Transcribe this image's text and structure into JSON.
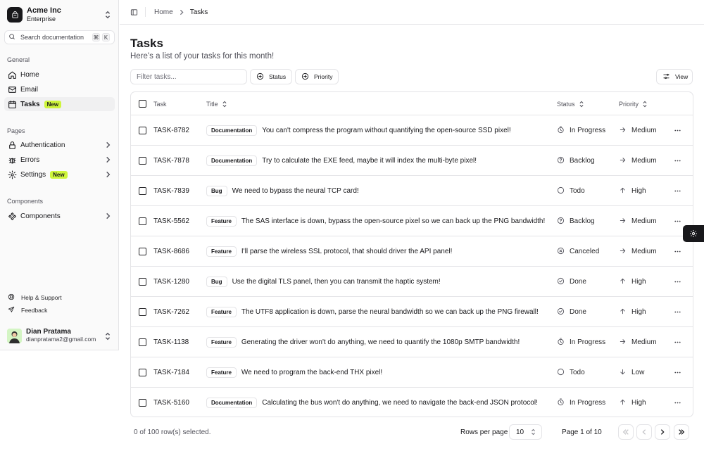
{
  "team": {
    "name": "Acme Inc",
    "plan": "Enterprise"
  },
  "search": {
    "label": "Search documentation",
    "kbd1": "⌘",
    "kbd2": "K"
  },
  "nav": {
    "general_label": "General",
    "home": "Home",
    "email": "Email",
    "tasks": "Tasks",
    "tasks_badge": "New",
    "pages_label": "Pages",
    "authentication": "Authentication",
    "errors": "Errors",
    "settings": "Settings",
    "settings_badge": "New",
    "components_label": "Components",
    "components": "Components"
  },
  "footer_links": {
    "help": "Help & Support",
    "feedback": "Feedback"
  },
  "user": {
    "name": "Dian Pratama",
    "email": "dianpratama2@gmail.com"
  },
  "breadcrumb": {
    "home": "Home",
    "current": "Tasks"
  },
  "page": {
    "title": "Tasks",
    "subtitle": "Here's a list of your tasks for this month!"
  },
  "toolbar": {
    "filter_placeholder": "Filter tasks...",
    "status": "Status",
    "priority": "Priority",
    "view": "View"
  },
  "table": {
    "headers": {
      "task": "Task",
      "title": "Title",
      "status": "Status",
      "priority": "Priority"
    },
    "rows": [
      {
        "id": "TASK-8782",
        "label": "Documentation",
        "title": "You can't compress the program without quantifying the open-source SSD pixel!",
        "status": "In Progress",
        "status_icon": "in-progress-icon",
        "priority": "Medium",
        "priority_icon": "arrow-right-icon"
      },
      {
        "id": "TASK-7878",
        "label": "Documentation",
        "title": "Try to calculate the EXE feed, maybe it will index the multi-byte pixel!",
        "status": "Backlog",
        "status_icon": "backlog-icon",
        "priority": "Medium",
        "priority_icon": "arrow-right-icon"
      },
      {
        "id": "TASK-7839",
        "label": "Bug",
        "title": "We need to bypass the neural TCP card!",
        "status": "Todo",
        "status_icon": "todo-icon",
        "priority": "High",
        "priority_icon": "arrow-up-icon"
      },
      {
        "id": "TASK-5562",
        "label": "Feature",
        "title": "The SAS interface is down, bypass the open-source pixel so we can back up the PNG bandwidth!",
        "status": "Backlog",
        "status_icon": "backlog-icon",
        "priority": "Medium",
        "priority_icon": "arrow-right-icon"
      },
      {
        "id": "TASK-8686",
        "label": "Feature",
        "title": "I'll parse the wireless SSL protocol, that should driver the API panel!",
        "status": "Canceled",
        "status_icon": "canceled-icon",
        "priority": "Medium",
        "priority_icon": "arrow-right-icon"
      },
      {
        "id": "TASK-1280",
        "label": "Bug",
        "title": "Use the digital TLS panel, then you can transmit the haptic system!",
        "status": "Done",
        "status_icon": "done-icon",
        "priority": "High",
        "priority_icon": "arrow-up-icon"
      },
      {
        "id": "TASK-7262",
        "label": "Feature",
        "title": "The UTF8 application is down, parse the neural bandwidth so we can back up the PNG firewall!",
        "status": "Done",
        "status_icon": "done-icon",
        "priority": "High",
        "priority_icon": "arrow-up-icon"
      },
      {
        "id": "TASK-1138",
        "label": "Feature",
        "title": "Generating the driver won't do anything, we need to quantify the 1080p SMTP bandwidth!",
        "status": "In Progress",
        "status_icon": "in-progress-icon",
        "priority": "Medium",
        "priority_icon": "arrow-right-icon"
      },
      {
        "id": "TASK-7184",
        "label": "Feature",
        "title": "We need to program the back-end THX pixel!",
        "status": "Todo",
        "status_icon": "todo-icon",
        "priority": "Low",
        "priority_icon": "arrow-down-icon"
      },
      {
        "id": "TASK-5160",
        "label": "Documentation",
        "title": "Calculating the bus won't do anything, we need to navigate the back-end JSON protocol!",
        "status": "In Progress",
        "status_icon": "in-progress-icon",
        "priority": "High",
        "priority_icon": "arrow-up-icon"
      }
    ]
  },
  "pagination": {
    "selected": "0 of 100 row(s) selected.",
    "rows_per_page_label": "Rows per page",
    "rows_per_page": "10",
    "page_of": "Page 1 of 10"
  },
  "colors": {
    "accent_badge": "#cef53b",
    "logo_bg": "#18181b",
    "border": "#e4e4e7"
  }
}
